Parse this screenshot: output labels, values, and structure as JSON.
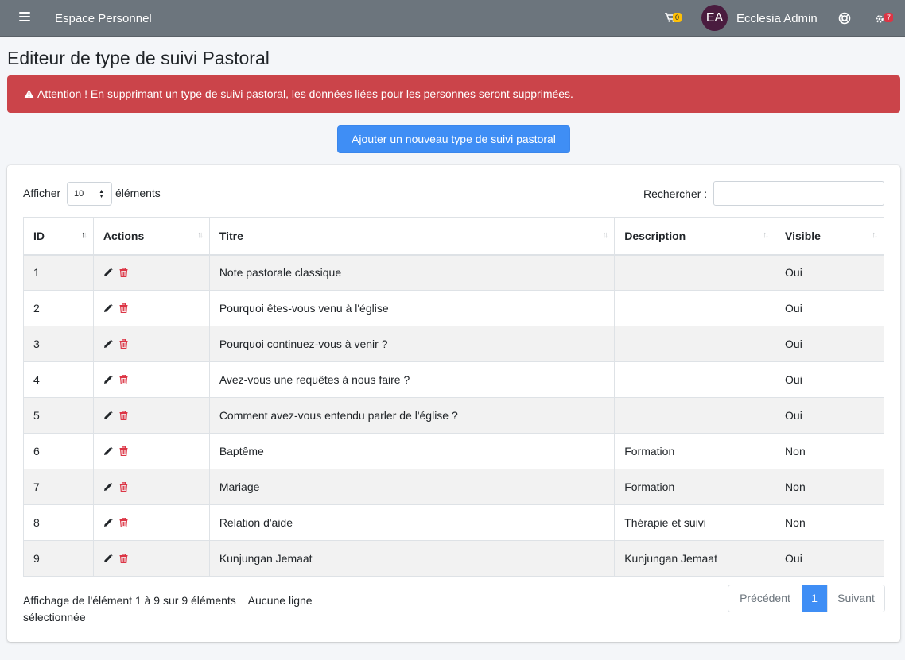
{
  "navbar": {
    "brand": "Espace Personnel",
    "cart_count": "0",
    "avatar_initials": "EA",
    "username": "Ecclesia Admin",
    "notif_count": "7"
  },
  "page": {
    "title": "Editeur de type de suivi Pastoral"
  },
  "alert": {
    "text": "Attention ! En supprimant un type de suivi pastoral, les données liées pour les personnes seront supprimées.",
    "color": "#cb444a"
  },
  "add_button": "Ajouter un nouveau type de suivi pastoral",
  "table_controls": {
    "show_label": "Afficher",
    "page_length": "10",
    "elements_label": "éléments",
    "search_label": "Rechercher :",
    "search_value": ""
  },
  "table": {
    "headers": [
      "ID",
      "Actions",
      "Titre",
      "Description",
      "Visible"
    ],
    "rows": [
      {
        "id": "1",
        "titre": "Note pastorale classique",
        "description": "",
        "visible": "Oui"
      },
      {
        "id": "2",
        "titre": "Pourquoi êtes-vous venu à l'église",
        "description": "",
        "visible": "Oui"
      },
      {
        "id": "3",
        "titre": "Pourquoi continuez-vous à venir ?",
        "description": "",
        "visible": "Oui"
      },
      {
        "id": "4",
        "titre": "Avez-vous une requêtes à nous faire ?",
        "description": "",
        "visible": "Oui"
      },
      {
        "id": "5",
        "titre": "Comment avez-vous entendu parler de l'église ?",
        "description": "",
        "visible": "Oui"
      },
      {
        "id": "6",
        "titre": "Baptême",
        "description": "Formation",
        "visible": "Non"
      },
      {
        "id": "7",
        "titre": "Mariage",
        "description": "Formation",
        "visible": "Non"
      },
      {
        "id": "8",
        "titre": "Relation d'aide",
        "description": "Thérapie et suivi",
        "visible": "Non"
      },
      {
        "id": "9",
        "titre": "Kunjungan Jemaat",
        "description": "Kunjungan Jemaat",
        "visible": "Oui"
      }
    ]
  },
  "footer": {
    "info": "Affichage de l'élément 1 à 9 sur 9 éléments",
    "selection": "Aucune ligne sélectionnée",
    "prev": "Précédent",
    "current_page": "1",
    "next": "Suivant"
  },
  "colors": {
    "navbar": "#6c757d",
    "primary": "#3f8ef5",
    "danger": "#dc3545"
  }
}
